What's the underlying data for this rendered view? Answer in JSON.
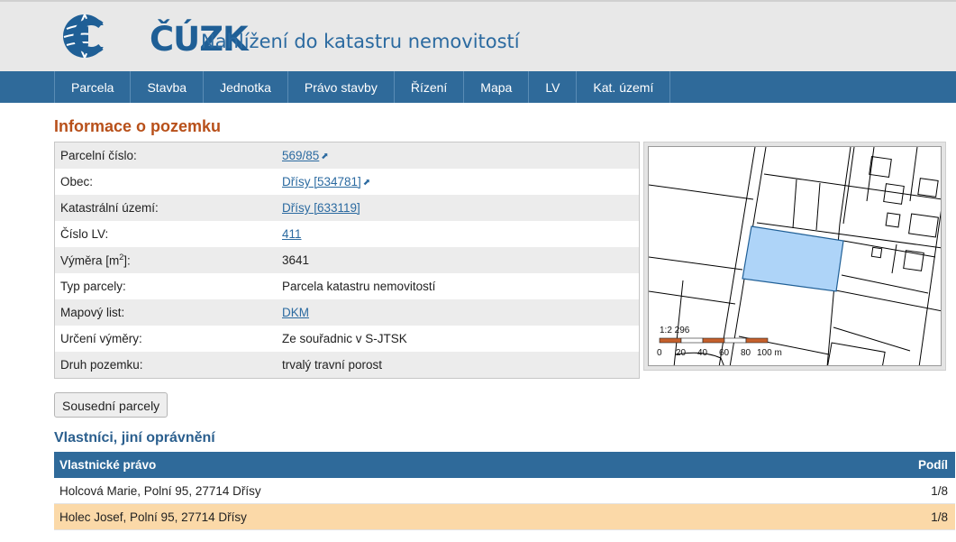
{
  "header": {
    "logo_text": "ČÚZK",
    "site_title": "Nahlížení do katastru nemovitostí"
  },
  "nav": {
    "items": [
      "Parcela",
      "Stavba",
      "Jednotka",
      "Právo stavby",
      "Řízení",
      "Mapa",
      "LV",
      "Kat. území"
    ]
  },
  "info": {
    "title": "Informace o pozemku",
    "rows": [
      {
        "label": "Parcelní číslo:",
        "value": "569/85",
        "link": true,
        "ext": true
      },
      {
        "label": "Obec:",
        "value": "Dřísy [534781]",
        "link": true,
        "ext": true
      },
      {
        "label": "Katastrální území:",
        "value": "Dřísy [633119]",
        "link": true,
        "ext": false
      },
      {
        "label": "Číslo LV:",
        "value": "411",
        "link": true,
        "ext": false
      },
      {
        "label_main": "Výměra [m",
        "label_sup": "2",
        "label_end": "]:",
        "value": "3641",
        "link": false,
        "ext": false
      },
      {
        "label": "Typ parcely:",
        "value": "Parcela katastru nemovitostí",
        "link": false,
        "ext": false
      },
      {
        "label": "Mapový list:",
        "value": "DKM",
        "link": true,
        "ext": false
      },
      {
        "label": "Určení výměry:",
        "value": "Ze souřadnic v S-JTSK",
        "link": false,
        "ext": false
      },
      {
        "label": "Druh pozemku:",
        "value": "trvalý travní porost",
        "link": false,
        "ext": false
      }
    ]
  },
  "map": {
    "scale_text": "1:2 296",
    "scale_ticks": [
      "0",
      "20",
      "40",
      "60",
      "80",
      "100 m"
    ],
    "parcel_fill": "#aed4f8",
    "parcel_stroke": "#1f5f96"
  },
  "buttons": {
    "neighbors": "Sousední parcely"
  },
  "owners": {
    "title": "Vlastníci, jiní oprávnění",
    "col_owner": "Vlastnické právo",
    "col_share": "Podíl",
    "rows": [
      {
        "owner": "Holcová Marie, Polní 95, 27714 Dřísy",
        "share": "1/8",
        "highlight": false
      },
      {
        "owner": "Holec Josef, Polní 95, 27714 Dřísy",
        "share": "1/8",
        "highlight": true
      }
    ]
  },
  "colors": {
    "nav_bg": "#2f6a9a",
    "title_orange": "#b8501a",
    "highlight_row": "#fbd9a8"
  },
  "icons": [
    "external-link-icon",
    "cuzk-globe-logo"
  ]
}
